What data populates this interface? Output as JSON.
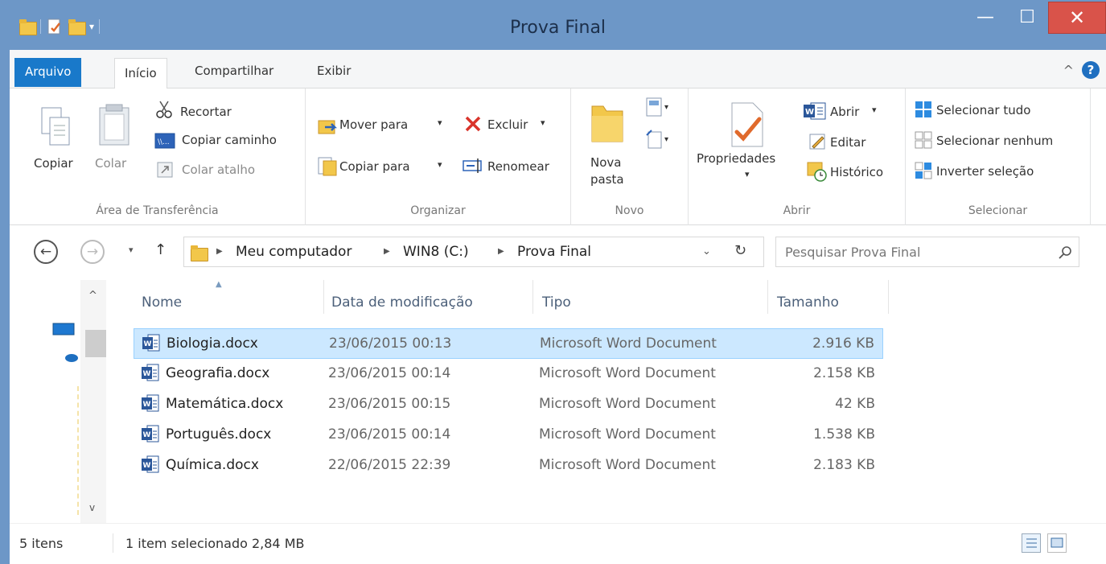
{
  "window": {
    "title": "Prova Final",
    "minimize_label": "—",
    "maximize_label": "☐",
    "close_label": "✕"
  },
  "tabs": [
    {
      "label": "Arquivo"
    },
    {
      "label": "Início"
    },
    {
      "label": "Compartilhar"
    },
    {
      "label": "Exibir"
    }
  ],
  "ribbon": {
    "clipboard": {
      "copy": "Copiar",
      "paste": "Colar",
      "cut": "Recortar",
      "copy_path": "Copiar caminho",
      "paste_shortcut": "Colar atalho",
      "group": "Área de Transferência"
    },
    "organize": {
      "move_to": "Mover para",
      "copy_to": "Copiar para",
      "delete": "Excluir",
      "rename": "Renomear",
      "group": "Organizar"
    },
    "new": {
      "new_folder_1": "Nova",
      "new_folder_2": "pasta",
      "group": "Novo"
    },
    "open": {
      "properties": "Propriedades",
      "open": "Abrir",
      "edit": "Editar",
      "history": "Histórico",
      "group": "Abrir"
    },
    "select": {
      "select_all": "Selecionar tudo",
      "select_none": "Selecionar nenhum",
      "invert": "Inverter seleção",
      "group": "Selecionar"
    }
  },
  "address": {
    "crumbs": [
      "Meu computador",
      "WIN8 (C:)",
      "Prova Final"
    ],
    "search_placeholder": "Pesquisar Prova Final"
  },
  "columns": {
    "name": "Nome",
    "date": "Data de modificação",
    "type": "Tipo",
    "size": "Tamanho"
  },
  "files": [
    {
      "name": "Biologia.docx",
      "date": "23/06/2015 00:13",
      "type": "Microsoft Word Document",
      "size": "2.916 KB",
      "selected": true
    },
    {
      "name": "Geografia.docx",
      "date": "23/06/2015 00:14",
      "type": "Microsoft Word Document",
      "size": "2.158 KB",
      "selected": false
    },
    {
      "name": "Matemática.docx",
      "date": "23/06/2015 00:15",
      "type": "Microsoft Word Document",
      "size": "42 KB",
      "selected": false
    },
    {
      "name": "Português.docx",
      "date": "23/06/2015 00:14",
      "type": "Microsoft Word Document",
      "size": "1.538 KB",
      "selected": false
    },
    {
      "name": "Química.docx",
      "date": "22/06/2015 22:39",
      "type": "Microsoft Word Document",
      "size": "2.183 KB",
      "selected": false
    }
  ],
  "status": {
    "count": "5 itens",
    "selection": "1 item selecionado  2,84 MB"
  },
  "colors": {
    "titlebar": "#6d97c7",
    "file_tab": "#1979ca",
    "selection": "#cce8ff",
    "close": "#d9534a"
  }
}
